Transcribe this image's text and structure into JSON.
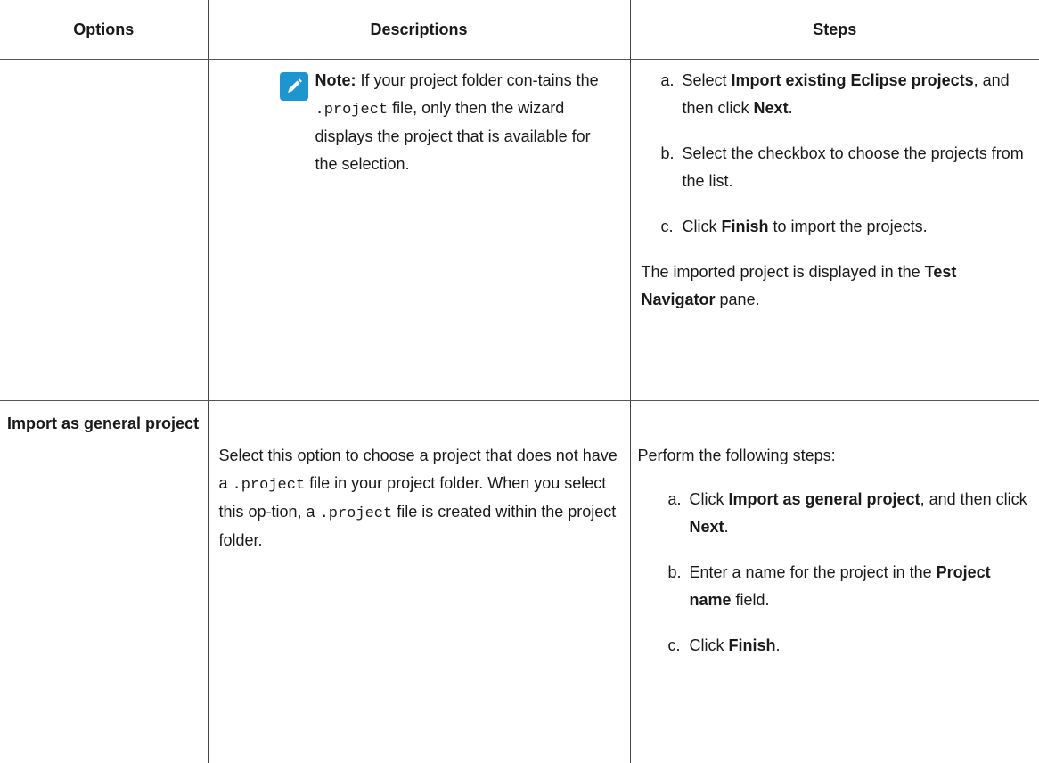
{
  "headers": {
    "options": "Options",
    "descriptions": "Descriptions",
    "steps": "Steps"
  },
  "row1": {
    "note": {
      "icon": "pencil-note-icon",
      "label": "Note:",
      "text_before": " If your project folder con-tains the ",
      "code": ".project",
      "text_after": " file, only then the wizard displays the project that is available for the selection."
    },
    "steps": [
      {
        "marker": "a.",
        "pre": "Select ",
        "bold": "Import existing Eclipse projects",
        "mid": ", and then click ",
        "bold2": "Next",
        "post": "."
      },
      {
        "marker": "b.",
        "pre": "Select the checkbox to choose the projects from the list.",
        "bold": "",
        "mid": "",
        "bold2": "",
        "post": ""
      },
      {
        "marker": "c.",
        "pre": "Click ",
        "bold": "Finish",
        "mid": " to import the projects.",
        "bold2": "",
        "post": ""
      }
    ],
    "tail": {
      "pre": "The imported project is displayed in the ",
      "bold": "Test Navigator",
      "post": " pane."
    }
  },
  "row2": {
    "option": "Import as general project",
    "description": {
      "t1": "Select this option to choose a project that does not have a ",
      "code1": ".project",
      "t2": " file in your project folder. When you select this op-tion, a ",
      "code2": ".project",
      "t3": " file is created within the project folder."
    },
    "intro": "Perform the following steps:",
    "steps": [
      {
        "marker": "a.",
        "pre": "Click ",
        "bold": "Import as general project",
        "mid": ", and then click ",
        "bold2": "Next",
        "post": "."
      },
      {
        "marker": "b.",
        "pre": "Enter a name for the project in the ",
        "bold": "Project name",
        "mid": " field.",
        "bold2": "",
        "post": ""
      },
      {
        "marker": "c.",
        "pre": "Click ",
        "bold": "Finish",
        "mid": ".",
        "bold2": "",
        "post": ""
      }
    ]
  },
  "colors": {
    "note_icon_bg": "#1b96d1",
    "text": "#1a1a1a",
    "rule": "#555555"
  }
}
